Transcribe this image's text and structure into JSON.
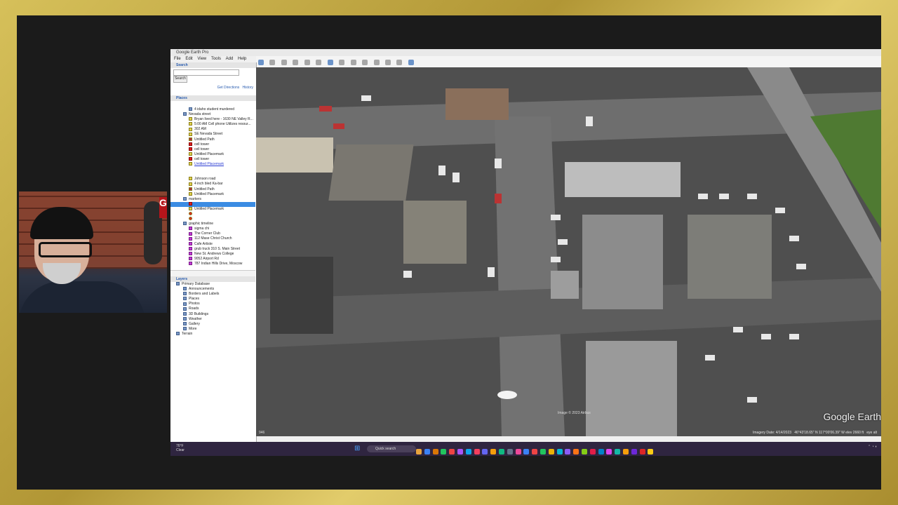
{
  "window": {
    "title": "Google Earth Pro",
    "menu": [
      "File",
      "Edit",
      "View",
      "Tools",
      "Add",
      "Help"
    ]
  },
  "search": {
    "section_label": "Search",
    "input_value": "",
    "button_label": "Search",
    "get_directions": "Get Directions",
    "history": "History"
  },
  "places": {
    "section_label": "Places",
    "items": [
      {
        "label": "4 idaho student murdered",
        "icon": "folder-icon",
        "state": ""
      },
      {
        "label": "Nevada street",
        "icon": "folder-icon",
        "state": ""
      },
      {
        "label": "Bryan lived here - 1630 NE Valley R...",
        "icon": "placemark-yellow-icon",
        "state": ""
      },
      {
        "label": "5:00 AM Cell phone Utilizes resour...",
        "icon": "placemark-yellow-icon",
        "state": ""
      },
      {
        "label": "302 AM",
        "icon": "placemark-yellow-icon",
        "state": ""
      },
      {
        "label": "SE Nevada Street",
        "icon": "placemark-yellow-icon",
        "state": ""
      },
      {
        "label": "Untitled Path",
        "icon": "path-icon",
        "state": ""
      },
      {
        "label": "cell tower",
        "icon": "tower-icon",
        "state": ""
      },
      {
        "label": "cell tower",
        "icon": "tower-icon",
        "state": ""
      },
      {
        "label": "Untitled Placemark",
        "icon": "placemark-yellow-icon",
        "state": ""
      },
      {
        "label": "cell tower",
        "icon": "tower-icon",
        "state": ""
      },
      {
        "label": "Untitled Placemark",
        "icon": "placemark-yellow-icon",
        "state": "link"
      },
      {
        "label": "",
        "icon": "",
        "state": "dim"
      },
      {
        "label": "",
        "icon": "",
        "state": "dim"
      },
      {
        "label": "Johnson road",
        "icon": "placemark-yellow-icon",
        "state": ""
      },
      {
        "label": "4 inch bled Ka-bar",
        "icon": "placemark-yellow-icon",
        "state": ""
      },
      {
        "label": "Untitled Path",
        "icon": "path-icon",
        "state": ""
      },
      {
        "label": "Untitled Placemark",
        "icon": "placemark-yellow-icon",
        "state": ""
      },
      {
        "label": "markers",
        "icon": "folder-icon",
        "state": ""
      },
      {
        "label": "",
        "icon": "placemark-red-icon",
        "state": "selected"
      },
      {
        "label": "Untitled Placemark",
        "icon": "placemark-yellow-icon",
        "state": ""
      },
      {
        "label": "",
        "icon": "pin-icon",
        "state": ""
      },
      {
        "label": "",
        "icon": "pin-icon",
        "state": ""
      },
      {
        "label": "graphic timeline",
        "icon": "folder-icon",
        "state": ""
      },
      {
        "label": "sigma chi",
        "icon": "placemark-purple-icon",
        "state": ""
      },
      {
        "label": "The Corner Club",
        "icon": "placemark-purple-icon",
        "state": ""
      },
      {
        "label": "112 Mase Christ Church",
        "icon": "placemark-purple-icon",
        "state": ""
      },
      {
        "label": "Cafe Artiste",
        "icon": "placemark-purple-icon",
        "state": ""
      },
      {
        "label": "grub truck 310 S. Main Street",
        "icon": "placemark-purple-icon",
        "state": ""
      },
      {
        "label": "New St. Andrews College",
        "icon": "placemark-purple-icon",
        "state": ""
      },
      {
        "label": "9052 Airport Rd",
        "icon": "placemark-purple-icon",
        "state": ""
      },
      {
        "label": "787 Indian Hills Drive, Moscow",
        "icon": "placemark-purple-icon",
        "state": ""
      }
    ]
  },
  "layers": {
    "section_label": "Layers",
    "items": [
      {
        "label": "Primary Database",
        "icon": "globe-icon"
      },
      {
        "label": "Announcements",
        "icon": "folder-icon"
      },
      {
        "label": "Borders and Labels",
        "icon": "folder-icon"
      },
      {
        "label": "Places",
        "icon": "folder-icon"
      },
      {
        "label": "Photos",
        "icon": "folder-icon"
      },
      {
        "label": "Roads",
        "icon": "folder-icon"
      },
      {
        "label": "3D Buildings",
        "icon": "folder-icon"
      },
      {
        "label": "Weather",
        "icon": "folder-icon"
      },
      {
        "label": "Gallery",
        "icon": "folder-icon"
      },
      {
        "label": "More",
        "icon": "folder-icon"
      },
      {
        "label": "Terrain",
        "icon": "checkbox-icon"
      }
    ]
  },
  "map": {
    "brand": "Google Earth",
    "copyright": "Image © 2023 Airbus",
    "imagery_date": "Imagery Date: 4/14/2023",
    "coordinates": "46°43'18.65\" N  117°00'06.39\" W  elev 2660 ft",
    "eye_alt": "eye alt",
    "scale_label": "946"
  },
  "taskbar": {
    "weather_temp": "76°F",
    "weather_desc": "Clear",
    "search_placeholder": "Quick search",
    "app_colors": [
      "#e8a33d",
      "#3b82f6",
      "#d97706",
      "#22c55e",
      "#ef4444",
      "#a855f7",
      "#0ea5e9",
      "#f43f5e",
      "#6366f1",
      "#f59e0b",
      "#10b981",
      "#64748b",
      "#ec4899",
      "#3b82f6",
      "#ef4444",
      "#22c55e",
      "#eab308",
      "#06b6d4",
      "#8b5cf6",
      "#f97316",
      "#84cc16",
      "#e11d48",
      "#0284c7",
      "#d946ef",
      "#14b8a6",
      "#f59e0b",
      "#6d28d9",
      "#dc2626",
      "#facc15"
    ]
  },
  "overlay": {
    "logo_text": "G"
  }
}
